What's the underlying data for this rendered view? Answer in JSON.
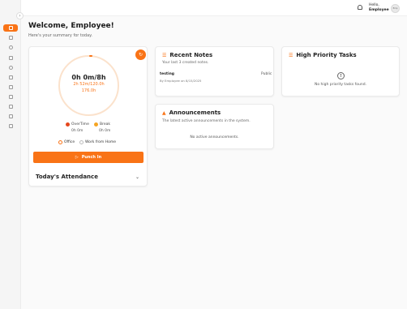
{
  "header": {
    "greeting_line1": "Hello,",
    "greeting_line2": "Employee",
    "avatar_text": "Emp"
  },
  "sidebar": {
    "toggle_glyph": "›",
    "items": [
      {
        "icon": "menu-icon",
        "active": true
      },
      {
        "icon": "folder-icon"
      },
      {
        "icon": "clock-icon"
      },
      {
        "icon": "chart-icon"
      },
      {
        "icon": "alarm-icon"
      },
      {
        "icon": "calendar-icon"
      },
      {
        "icon": "calendar-check-icon"
      },
      {
        "icon": "list-icon"
      },
      {
        "icon": "document-icon"
      },
      {
        "icon": "clipboard-icon"
      },
      {
        "icon": "users-icon"
      }
    ]
  },
  "page": {
    "title": "Welcome, Employee!",
    "subtitle": "Here's your summary for today."
  },
  "attendance": {
    "timer": "0h 0m/8h",
    "worked": "2h 52m/120.0h",
    "total": "176.0h",
    "overtime_label": "OverTime",
    "overtime_value": "0h 0m",
    "break_label": "Break",
    "break_value": "0h 0m",
    "office_label": "Office",
    "wfh_label": "Work from Home",
    "punch_label": "Punch In",
    "today_label": "Today's Attendance",
    "colors": {
      "accent": "#f97316",
      "overtime": "#e5471d",
      "break": "#f5a524"
    }
  },
  "notes": {
    "title": "Recent Notes",
    "subtitle": "Your last 3 created notes.",
    "items": [
      {
        "title": "testing",
        "visibility": "Public",
        "meta": "By Employee on 8/15/2025"
      }
    ]
  },
  "announcements": {
    "title": "Announcements",
    "subtitle": "The latest active announcements in the system.",
    "empty": "No active announcements."
  },
  "tasks": {
    "title": "High Priority Tasks",
    "empty": "No high priority tasks found."
  }
}
